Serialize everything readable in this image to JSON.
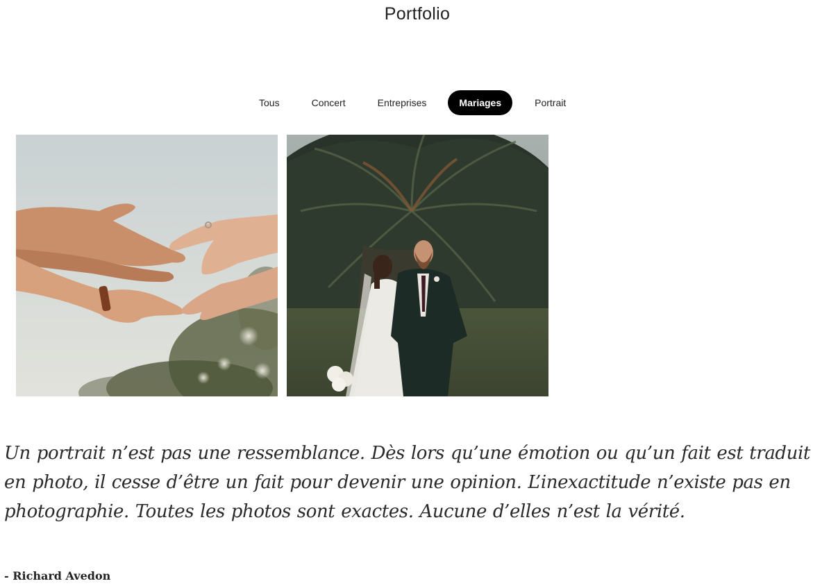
{
  "header": {
    "title": "Portfolio"
  },
  "filters": {
    "items": [
      {
        "label": "Tous",
        "active": false
      },
      {
        "label": "Concert",
        "active": false
      },
      {
        "label": "Entreprises",
        "active": false
      },
      {
        "label": "Mariages",
        "active": true
      },
      {
        "label": "Portrait",
        "active": false
      }
    ]
  },
  "gallery": {
    "photos": [
      {
        "subject": "hands-reaching-with-ring"
      },
      {
        "subject": "bride-and-groom-under-palm-tree"
      }
    ]
  },
  "quote": {
    "text": "Un portrait n’est pas une ressemblance. Dès lors qu’une émotion ou qu’un fait est traduit en photo, il cesse d’être un fait pour devenir une opinion. L’inexactitude n’existe pas en photographie. Toutes les photos sont exactes. Aucune d’elles n’est la vérité.",
    "author": "- Richard Avedon"
  },
  "colors": {
    "active_filter_bg": "#000000",
    "active_filter_text": "#ffffff",
    "text": "#222222"
  }
}
